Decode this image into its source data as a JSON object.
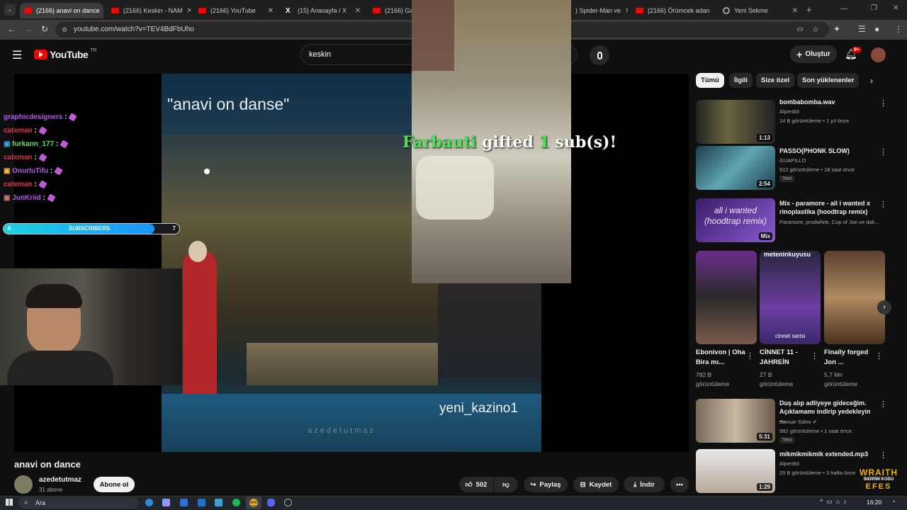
{
  "browser": {
    "tabs": [
      {
        "label": "(2166) anavi on dance",
        "icon": "youtube-icon",
        "active": true
      },
      {
        "label": "(2166) Keskin - NAM",
        "icon": "youtube-icon"
      },
      {
        "label": "(2166) YouTube",
        "icon": "youtube-icon"
      },
      {
        "label": "(15) Anasayfa / X",
        "icon": "x-icon"
      },
      {
        "label": "(2166) Gam",
        "icon": "youtube-icon"
      },
      {
        "label": ") Spider-Man ve",
        "icon": "youtube-icon"
      },
      {
        "label": "(2166) Örümcek adan",
        "icon": "youtube-icon"
      },
      {
        "label": "Yeni Sekme",
        "icon": "chrome-icon"
      }
    ],
    "url": "youtube.com/watch?v=TEV4BdFbUho"
  },
  "header": {
    "logo": "YouTube",
    "region": "TR",
    "search_value": "keskin",
    "create_label": "Oluştur",
    "notifications": "9+"
  },
  "video": {
    "overlay_title": "\"anavi on danse\"",
    "overlay_credit": "yeni_kazino1",
    "overlay_watermark": "azedetutmaz",
    "gift_name": "Farbauti",
    "gift_text_mid": "gifted",
    "gift_count": "1",
    "gift_text_end": "sub(s)!",
    "chat": [
      {
        "user": "graphicdesigners",
        "color": "#b05cf2"
      },
      {
        "user": "catxman",
        "color": "#e0344a"
      },
      {
        "user": "furkann_177",
        "color": "#5fe05f"
      },
      {
        "user": "catxman",
        "color": "#e0344a"
      },
      {
        "user": "OnurluTifu",
        "color": "#b05cf2"
      },
      {
        "user": "catxman",
        "color": "#e0344a"
      },
      {
        "user": "JunKriid",
        "color": "#b05cf2"
      }
    ],
    "subbar_left": "6",
    "subbar_label": "SUBSCRIBERS",
    "subbar_right": "7",
    "subbar_progress": 0.86
  },
  "details": {
    "title": "anavi on dance",
    "channel": "azedetutmaz",
    "subs": "31 abone",
    "subscribe": "Abone ol",
    "likes": "502",
    "share": "Paylaş",
    "save": "Kaydet",
    "download": "İndir"
  },
  "chips": [
    "Tümü",
    "İlgili",
    "Size özel",
    "Son yüklenenler"
  ],
  "recommendations": [
    {
      "title": "bombabomba.wav",
      "channel": "Alperdüt",
      "meta": "14 B görüntüleme • 1 yıl önce",
      "duration": "1:13",
      "color": "#3d3a24"
    },
    {
      "title": "PASSO(PHONK SLOW)",
      "channel": "GUAPILLO",
      "meta": "912 görüntüleme • 18 saat önce",
      "duration": "2:54",
      "badge": "Yeni",
      "color": "#4a7d86"
    },
    {
      "title": "Mix - paramore - all i wanted x rinoplastika (hoodtrap remix)",
      "channel": "Paramore, prodwhite, Cup of Joe ve dah...",
      "duration": "Mix",
      "thumb_text": "all i wanted (hoodtrap remix)",
      "color": "#6a3aa0"
    },
    {
      "title": "Duş alıp adliyeye gideceğim. Açıklamamı indirip yedekleyin ...",
      "channel": "Sansar Salvo",
      "meta": "982 görüntüleme • 1 saat önce",
      "duration": "5:31",
      "badge": "Yeni",
      "color": "#a89886"
    },
    {
      "title": "mikmikmikmik extended.mp3",
      "channel": "Alperdüt",
      "meta": "29 B görüntüleme • 3 hafta önce",
      "duration": "1:29",
      "color": "#c9c9c9"
    }
  ],
  "shorts": [
    {
      "title": "Ebonivon | Oha Bira mı...",
      "views": "782 B görüntüleme",
      "color": "#5a2d6e"
    },
    {
      "title": "CİNNET 11 - JAHREİN",
      "views": "27 B görüntüleme",
      "thumb_top": "meteninkuyusu",
      "thumb_bottom": "cinnet serisi",
      "color": "#6b3fa0"
    },
    {
      "title": "Finally forged Jon ...",
      "views": "5,7 Mn görüntüleme",
      "color": "#8a6a4a"
    }
  ],
  "sponsor": {
    "line1": "WRAITH",
    "line2": "İNDİRİM KODU",
    "line3": "EFES"
  },
  "taskbar": {
    "search": "Ara",
    "time": "16:20"
  }
}
